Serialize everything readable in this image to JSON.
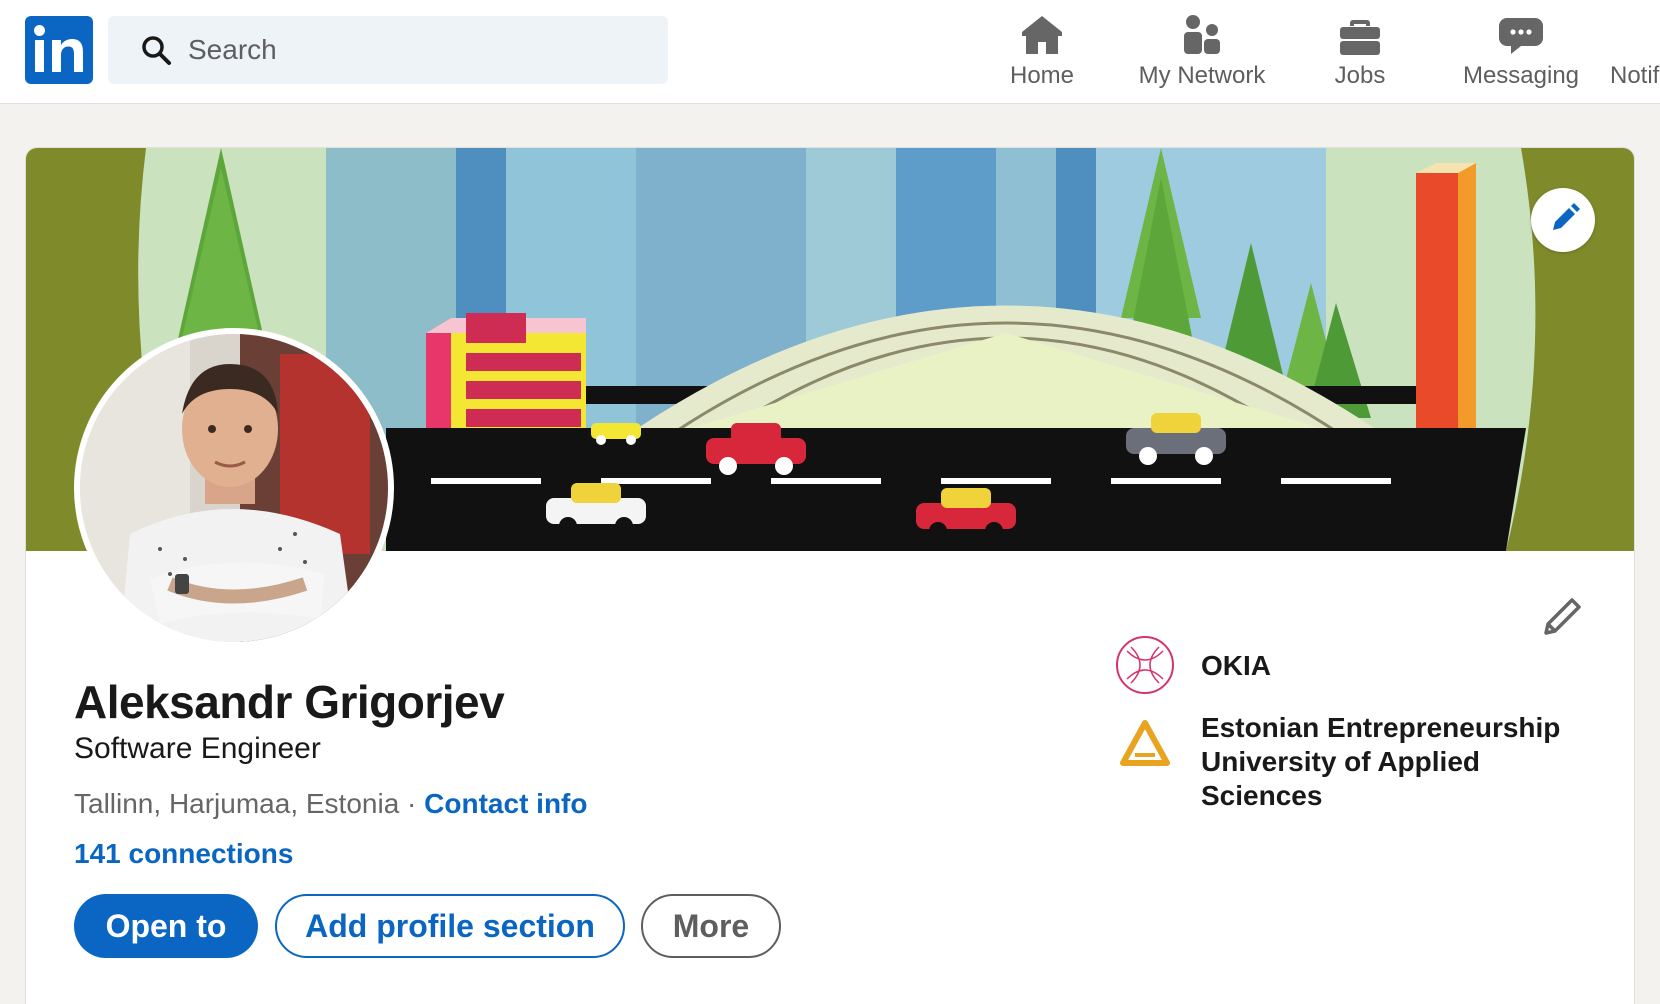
{
  "nav": {
    "search_placeholder": "Search",
    "items": [
      {
        "label": "Home",
        "icon": "home-icon"
      },
      {
        "label": "My Network",
        "icon": "people-icon"
      },
      {
        "label": "Jobs",
        "icon": "briefcase-icon"
      },
      {
        "label": "Messaging",
        "icon": "chat-icon"
      },
      {
        "label": "Notifi",
        "icon": "bell-icon"
      }
    ]
  },
  "profile": {
    "name": "Aleksandr Grigorjev",
    "headline": "Software Engineer",
    "location": "Tallinn, Harjumaa, Estonia",
    "separator": " · ",
    "contact_info": "Contact info",
    "connections": "141 connections"
  },
  "actions": {
    "open_to": "Open to",
    "add_section": "Add profile section",
    "more": "More"
  },
  "organizations": [
    {
      "name": "OKIA",
      "logo": "okia-logo"
    },
    {
      "name": "Estonian Entrepreneurship University of Applied Sciences",
      "logo": "university-logo"
    }
  ],
  "colors": {
    "brand": "#0a66c2",
    "background": "#f3f2ef",
    "banner_green": "#7f8a2b"
  }
}
